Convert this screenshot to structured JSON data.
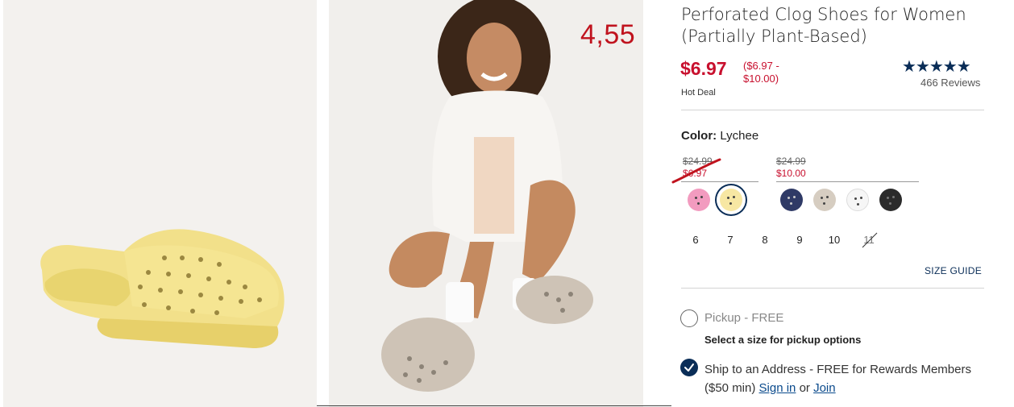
{
  "overlay_number": "4,55",
  "product": {
    "title": "Perforated Clog Shoes for Women (Partially Plant-Based)",
    "price": "$6.97",
    "price_range": "($6.97 - $10.00)",
    "deal_label": "Hot Deal",
    "rating_stars": "★★★★★",
    "rating_value": 4.5,
    "reviews": "466 Reviews"
  },
  "color": {
    "label": "Color:",
    "value": "Lychee",
    "groups": [
      {
        "original": "$24.99",
        "sale": "$6.97"
      },
      {
        "original": "$24.99",
        "sale": "$10.00"
      }
    ],
    "swatches": [
      {
        "name": "pink",
        "color": "#f29bbf",
        "selected": false
      },
      {
        "name": "lychee",
        "color": "#f7e7a3",
        "selected": true
      },
      {
        "name": "navy",
        "color": "#2f3a66",
        "selected": false
      },
      {
        "name": "taupe",
        "color": "#d6cdc1",
        "selected": false
      },
      {
        "name": "white",
        "color": "#f6f6f6",
        "selected": false
      },
      {
        "name": "black",
        "color": "#2b2b2b",
        "selected": false
      }
    ]
  },
  "sizes": [
    "6",
    "7",
    "8",
    "9",
    "10",
    "11"
  ],
  "size_guide": "SIZE GUIDE",
  "fulfillment": {
    "pickup_label": "Pickup - FREE",
    "pickup_note": "Select a size for pickup options",
    "ship_label": "Ship to an Address - FREE for Rewards Members ($50 min)",
    "sign_in": "Sign in",
    "or": "or",
    "join": "Join"
  },
  "colors": {
    "sale_red": "#c8102e",
    "navy": "#0a2d57",
    "overlay_red": "#c0131e"
  }
}
